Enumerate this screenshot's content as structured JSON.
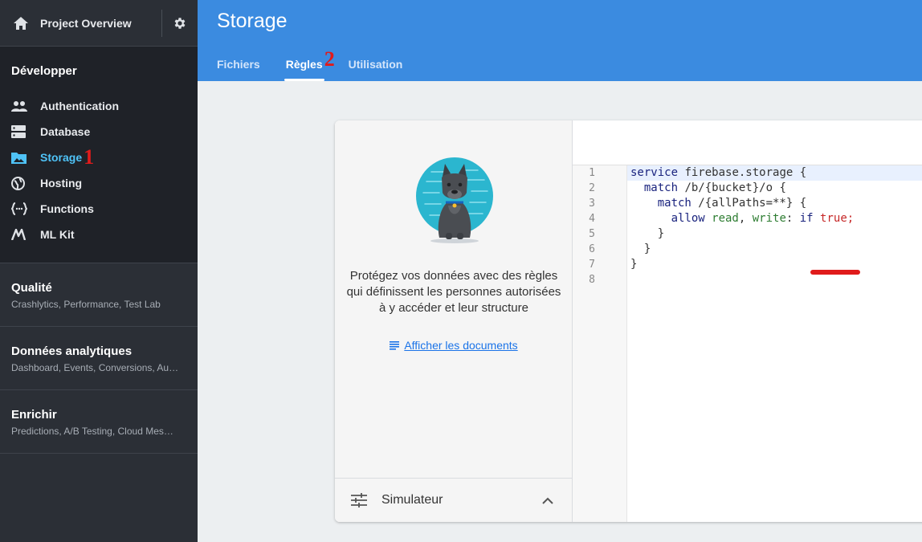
{
  "sidebar": {
    "project_title": "Project Overview",
    "dev_title": "Développer",
    "items": [
      {
        "label": "Authentication",
        "icon": "people-icon"
      },
      {
        "label": "Database",
        "icon": "database-icon"
      },
      {
        "label": "Storage",
        "icon": "folder-image-icon"
      },
      {
        "label": "Hosting",
        "icon": "globe-icon"
      },
      {
        "label": "Functions",
        "icon": "functions-icon"
      },
      {
        "label": "ML Kit",
        "icon": "mlkit-icon"
      }
    ],
    "storage_annotation": "1",
    "sections": [
      {
        "title": "Qualité",
        "subtitle": "Crashlytics, Performance, Test Lab"
      },
      {
        "title": "Données analytiques",
        "subtitle": "Dashboard, Events, Conversions, Au…"
      },
      {
        "title": "Enrichir",
        "subtitle": "Predictions, A/B Testing, Cloud Mes…"
      }
    ]
  },
  "header": {
    "title": "Storage",
    "tabs": [
      {
        "label": "Fichiers"
      },
      {
        "label": "Règles"
      },
      {
        "label": "Utilisation"
      }
    ],
    "rules_annotation": "2"
  },
  "left_panel": {
    "description": "Protégez vos données avec des règles qui définissent les personnes autorisées à y accéder et leur structure",
    "doc_link": "Afficher les documents",
    "simulator": "Simulateur"
  },
  "editor": {
    "line_numbers": [
      "1",
      "2",
      "3",
      "4",
      "5",
      "6",
      "7",
      "8"
    ],
    "l1a": "service",
    "l1b": " firebase.storage {",
    "l2a": "  match",
    "l2b": " /b/{bucket}/o {",
    "l3a": "    match",
    "l3b": " /{allPaths=**} {",
    "l4a": "      allow",
    "l4b": " read",
    "l4c": ", ",
    "l4d": "write",
    "l4e": ": ",
    "l4f": "if",
    "l4g": " true;",
    "l5": "    }",
    "l6": "  }",
    "l7": "}",
    "l8": ""
  },
  "colors": {
    "header": "#3b8be0",
    "sidebar": "#2b2f36",
    "active": "#4fc3f7",
    "annotation": "#e01b1b"
  }
}
